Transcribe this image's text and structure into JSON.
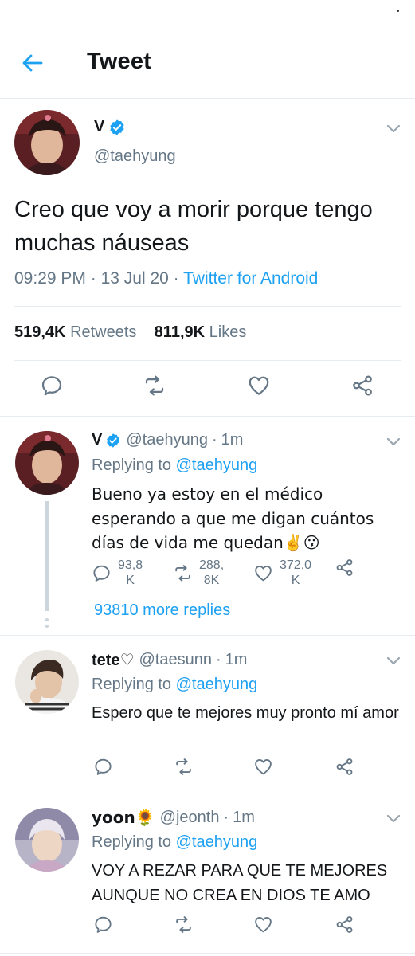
{
  "header": {
    "title": "Tweet"
  },
  "main_tweet": {
    "name": "V",
    "verified": true,
    "handle": "@taehyung",
    "text": "Creo que voy a morir porque tengo muchas náuseas",
    "time": "09:29 PM",
    "date": "13 Jul 20",
    "source": "Twitter for Android",
    "retweets_count": "519,4K",
    "retweets_label": "Retweets",
    "likes_count": "811,9K",
    "likes_label": "Likes"
  },
  "replies": [
    {
      "name": "V",
      "verified": true,
      "handle": "@taehyung",
      "time": "1m",
      "replying_prefix": "Replying to",
      "replying_to": "@taehyung",
      "text": "Bueno ya estoy en el médico esperando a que me digan cuántos días de vida me quedan✌️😗",
      "reply_count_line1": "93,8",
      "reply_count_line2": "K",
      "retweet_count_line1": "288,",
      "retweet_count_line2": "8K",
      "like_count_line1": "372,0",
      "like_count_line2": "K",
      "more_replies": "93810 more replies"
    },
    {
      "name": "tete♡",
      "handle": "@taesunn",
      "time": "1m",
      "replying_prefix": "Replying to",
      "replying_to": "@taehyung",
      "text": "Espero que te mejores muy pronto mí amor"
    },
    {
      "name": "yoon🌻",
      "handle": "@jeonth",
      "time": "1m",
      "replying_prefix": "Replying to",
      "replying_to": "@taehyung",
      "text": "VOY A REZAR PARA QUE TE MEJORES AUNQUE NO CREA EN DIOS TE AMO"
    }
  ],
  "separator": "·",
  "colors": {
    "accent": "#1da1f2",
    "muted": "#657786",
    "border": "#e6ecf0",
    "text": "#14171a"
  }
}
